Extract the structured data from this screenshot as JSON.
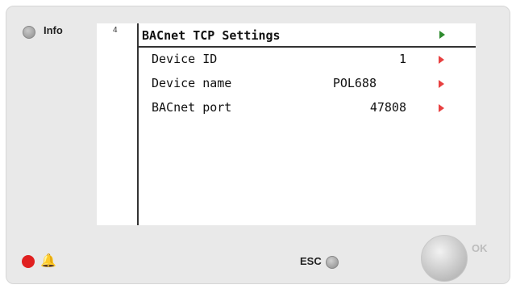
{
  "controls": {
    "info_label": "Info",
    "esc_label": "ESC",
    "ok_label": "OK",
    "bell_glyph": "🔔",
    "alarm_led_color": "#e02020"
  },
  "screen": {
    "page_number": "4",
    "title": "BACnet TCP Settings",
    "title_arrow_color": "#2e8b2e",
    "row_arrow_color": "#e84040",
    "rows": [
      {
        "label": "Device ID",
        "value": "1"
      },
      {
        "label": "Device name",
        "value": "POL688"
      },
      {
        "label": "BACnet port",
        "value": "47808"
      }
    ]
  }
}
